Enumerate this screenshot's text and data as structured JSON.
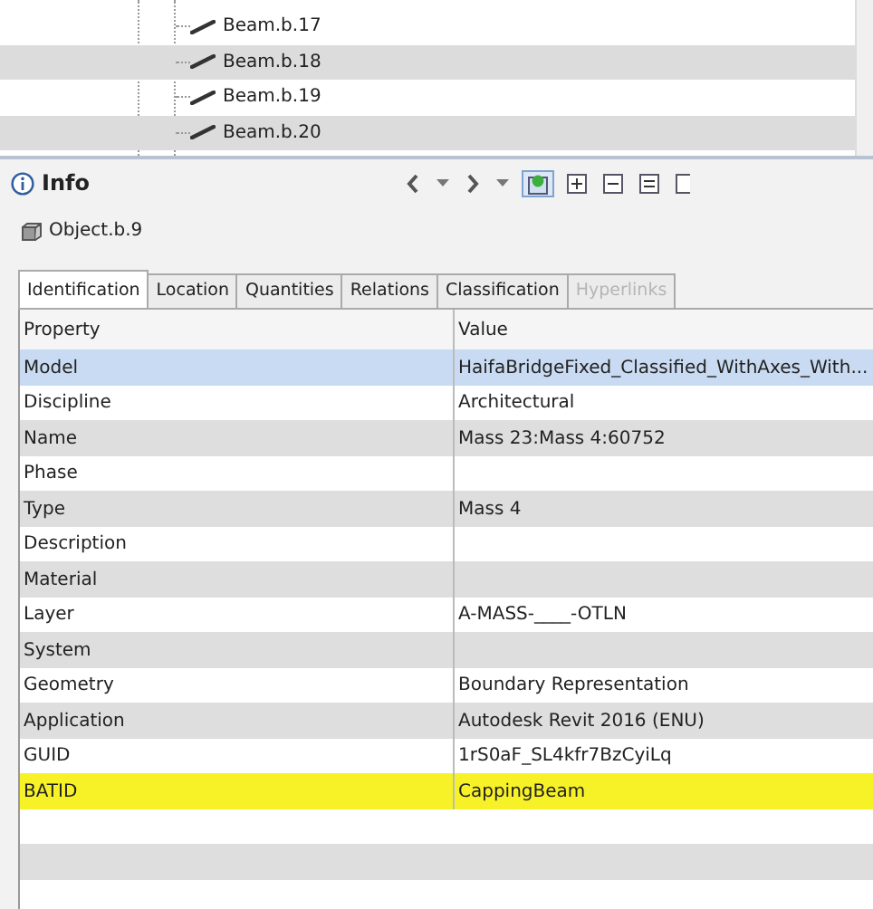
{
  "tree": {
    "items": [
      {
        "label": "Beam.b.17"
      },
      {
        "label": "Beam.b.18"
      },
      {
        "label": "Beam.b.19"
      },
      {
        "label": "Beam.b.20"
      }
    ]
  },
  "info_panel": {
    "title": "Info",
    "object": "Object.b.9",
    "tabs": [
      {
        "label": "Identification",
        "selected": true,
        "disabled": false
      },
      {
        "label": "Location",
        "selected": false,
        "disabled": false
      },
      {
        "label": "Quantities",
        "selected": false,
        "disabled": false
      },
      {
        "label": "Relations",
        "selected": false,
        "disabled": false
      },
      {
        "label": "Classification",
        "selected": false,
        "disabled": false
      },
      {
        "label": "Hyperlinks",
        "selected": false,
        "disabled": true
      }
    ],
    "table": {
      "columns": [
        "Property",
        "Value"
      ],
      "rows": [
        {
          "property": "Model",
          "value": "HaifaBridgeFixed_Classified_WithAxes_With...",
          "selected": true,
          "highlighted": false
        },
        {
          "property": "Discipline",
          "value": "Architectural",
          "selected": false,
          "highlighted": false
        },
        {
          "property": "Name",
          "value": "Mass 23:Mass 4:60752",
          "selected": false,
          "highlighted": false
        },
        {
          "property": "Phase",
          "selected": false,
          "highlighted": false
        },
        {
          "property": "Type",
          "value": "Mass 4",
          "selected": false,
          "highlighted": false
        },
        {
          "property": "Description",
          "selected": false,
          "highlighted": false
        },
        {
          "property": "Material",
          "selected": false,
          "highlighted": false
        },
        {
          "property": "Layer",
          "value": "A-MASS-____-OTLN",
          "selected": false,
          "highlighted": false
        },
        {
          "property": "System",
          "selected": false,
          "highlighted": false
        },
        {
          "property": "Geometry",
          "value": "Boundary Representation",
          "selected": false,
          "highlighted": false
        },
        {
          "property": "Application",
          "value": "Autodesk Revit 2016 (ENU)",
          "selected": false,
          "highlighted": false
        },
        {
          "property": "GUID",
          "value": "1rS0aF_SL4kfr7BzCyiLq",
          "selected": false,
          "highlighted": false
        },
        {
          "property": "BATID",
          "value": "CappingBeam",
          "selected": false,
          "highlighted": true
        }
      ]
    }
  }
}
